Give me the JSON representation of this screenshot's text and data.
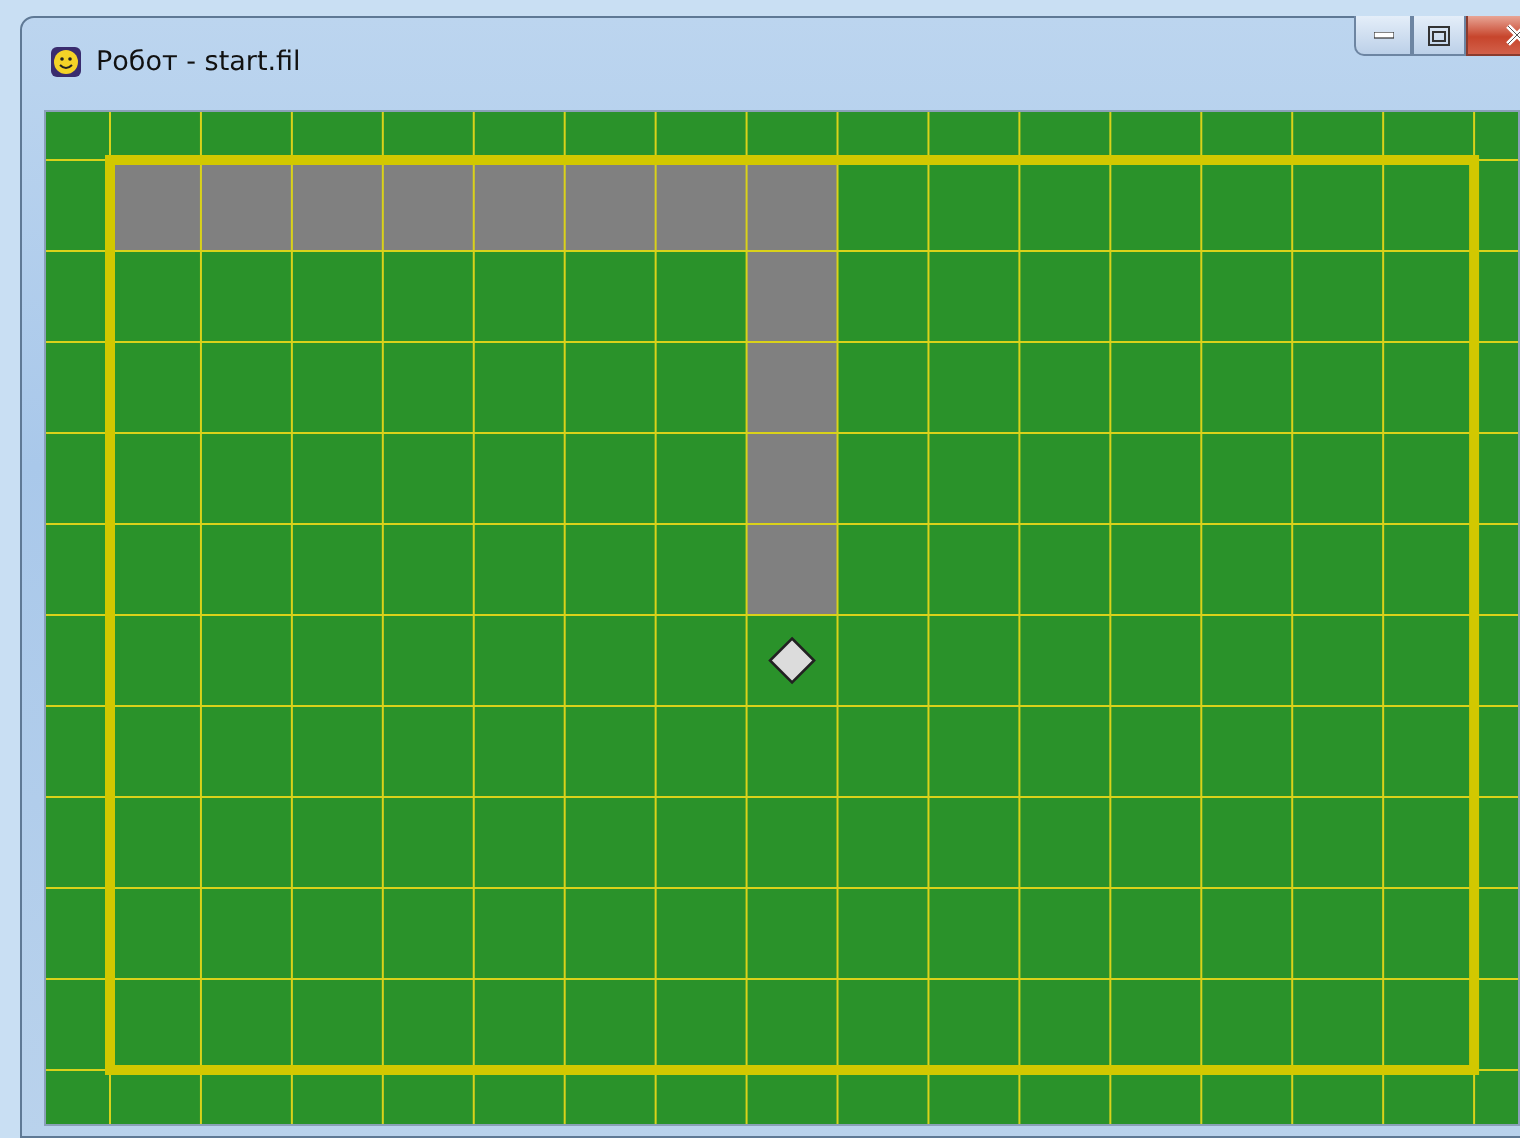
{
  "window": {
    "title": "Робот - start.fil"
  },
  "field": {
    "rows": [
      [
        {
          "kind": "painted"
        },
        {
          "kind": "painted"
        },
        {
          "kind": "painted"
        },
        {
          "kind": "painted"
        },
        {
          "kind": "painted"
        },
        {
          "kind": "painted"
        },
        {
          "kind": "painted"
        },
        {
          "kind": "painted"
        },
        {
          "kind": "empty"
        },
        {
          "kind": "empty"
        },
        {
          "kind": "empty"
        },
        {
          "kind": "empty"
        },
        {
          "kind": "empty"
        },
        {
          "kind": "empty"
        },
        {
          "kind": "empty"
        }
      ],
      [
        {
          "kind": "empty"
        },
        {
          "kind": "empty"
        },
        {
          "kind": "empty"
        },
        {
          "kind": "empty"
        },
        {
          "kind": "empty"
        },
        {
          "kind": "empty"
        },
        {
          "kind": "empty"
        },
        {
          "kind": "painted"
        },
        {
          "kind": "empty"
        },
        {
          "kind": "empty"
        },
        {
          "kind": "empty"
        },
        {
          "kind": "empty"
        },
        {
          "kind": "empty"
        },
        {
          "kind": "empty"
        },
        {
          "kind": "empty"
        }
      ],
      [
        {
          "kind": "empty"
        },
        {
          "kind": "empty"
        },
        {
          "kind": "empty"
        },
        {
          "kind": "empty"
        },
        {
          "kind": "empty"
        },
        {
          "kind": "empty"
        },
        {
          "kind": "empty"
        },
        {
          "kind": "painted"
        },
        {
          "kind": "empty"
        },
        {
          "kind": "empty"
        },
        {
          "kind": "empty"
        },
        {
          "kind": "empty"
        },
        {
          "kind": "empty"
        },
        {
          "kind": "empty"
        },
        {
          "kind": "empty"
        }
      ],
      [
        {
          "kind": "empty"
        },
        {
          "kind": "empty"
        },
        {
          "kind": "empty"
        },
        {
          "kind": "empty"
        },
        {
          "kind": "empty"
        },
        {
          "kind": "empty"
        },
        {
          "kind": "empty"
        },
        {
          "kind": "painted"
        },
        {
          "kind": "empty"
        },
        {
          "kind": "empty"
        },
        {
          "kind": "empty"
        },
        {
          "kind": "empty"
        },
        {
          "kind": "empty"
        },
        {
          "kind": "empty"
        },
        {
          "kind": "empty"
        }
      ],
      [
        {
          "kind": "empty"
        },
        {
          "kind": "empty"
        },
        {
          "kind": "empty"
        },
        {
          "kind": "empty"
        },
        {
          "kind": "empty"
        },
        {
          "kind": "empty"
        },
        {
          "kind": "empty"
        },
        {
          "kind": "painted"
        },
        {
          "kind": "empty"
        },
        {
          "kind": "empty"
        },
        {
          "kind": "empty"
        },
        {
          "kind": "empty"
        },
        {
          "kind": "empty"
        },
        {
          "kind": "empty"
        },
        {
          "kind": "empty"
        }
      ],
      [
        {
          "kind": "empty"
        },
        {
          "kind": "empty"
        },
        {
          "kind": "empty"
        },
        {
          "kind": "empty"
        },
        {
          "kind": "empty"
        },
        {
          "kind": "empty"
        },
        {
          "kind": "empty"
        },
        {
          "kind": "robot"
        },
        {
          "kind": "empty"
        },
        {
          "kind": "empty"
        },
        {
          "kind": "empty"
        },
        {
          "kind": "empty"
        },
        {
          "kind": "empty"
        },
        {
          "kind": "empty"
        },
        {
          "kind": "empty"
        }
      ],
      [
        {
          "kind": "empty"
        },
        {
          "kind": "empty"
        },
        {
          "kind": "empty"
        },
        {
          "kind": "empty"
        },
        {
          "kind": "empty"
        },
        {
          "kind": "empty"
        },
        {
          "kind": "empty"
        },
        {
          "kind": "empty"
        },
        {
          "kind": "empty"
        },
        {
          "kind": "empty"
        },
        {
          "kind": "empty"
        },
        {
          "kind": "empty"
        },
        {
          "kind": "empty"
        },
        {
          "kind": "empty"
        },
        {
          "kind": "empty"
        }
      ],
      [
        {
          "kind": "empty"
        },
        {
          "kind": "empty"
        },
        {
          "kind": "empty"
        },
        {
          "kind": "empty"
        },
        {
          "kind": "empty"
        },
        {
          "kind": "empty"
        },
        {
          "kind": "empty"
        },
        {
          "kind": "empty"
        },
        {
          "kind": "empty"
        },
        {
          "kind": "empty"
        },
        {
          "kind": "empty"
        },
        {
          "kind": "empty"
        },
        {
          "kind": "empty"
        },
        {
          "kind": "empty"
        },
        {
          "kind": "empty"
        }
      ],
      [
        {
          "kind": "empty"
        },
        {
          "kind": "empty"
        },
        {
          "kind": "empty"
        },
        {
          "kind": "empty"
        },
        {
          "kind": "empty"
        },
        {
          "kind": "empty"
        },
        {
          "kind": "empty"
        },
        {
          "kind": "empty"
        },
        {
          "kind": "empty"
        },
        {
          "kind": "empty"
        },
        {
          "kind": "empty"
        },
        {
          "kind": "empty"
        },
        {
          "kind": "empty"
        },
        {
          "kind": "empty"
        },
        {
          "kind": "empty"
        }
      ],
      [
        {
          "kind": "empty"
        },
        {
          "kind": "empty"
        },
        {
          "kind": "empty"
        },
        {
          "kind": "empty"
        },
        {
          "kind": "empty"
        },
        {
          "kind": "empty"
        },
        {
          "kind": "empty"
        },
        {
          "kind": "empty"
        },
        {
          "kind": "empty"
        },
        {
          "kind": "empty"
        },
        {
          "kind": "empty"
        },
        {
          "kind": "empty"
        },
        {
          "kind": "empty"
        },
        {
          "kind": "empty"
        },
        {
          "kind": "empty"
        }
      ]
    ]
  }
}
